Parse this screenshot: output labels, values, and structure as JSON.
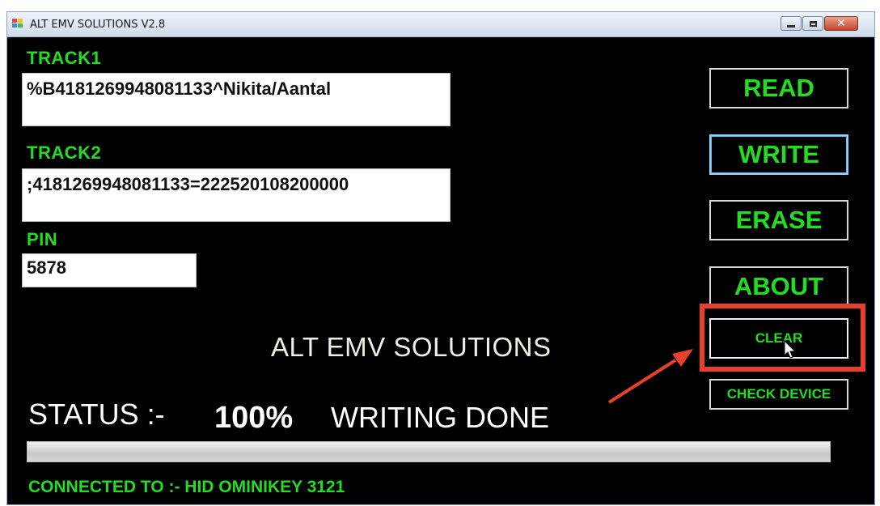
{
  "window": {
    "title": "ALT EMV SOLUTIONS V2.8",
    "close_glyph": "✕"
  },
  "fields": {
    "track1": {
      "label": "TRACK1",
      "value": "%B4181269948081133^Nikita/Aantal"
    },
    "track2": {
      "label": "TRACK2",
      "value": ";4181269948081133=222520108200000"
    },
    "pin": {
      "label": "PIN",
      "value": "5878"
    }
  },
  "buttons": {
    "read": "READ",
    "write": "WRITE",
    "erase": "ERASE",
    "about": "ABOUT",
    "clear": "CLEAR",
    "check_device": "CHECK DEVICE"
  },
  "brand_title": "ALT EMV SOLUTIONS",
  "status": {
    "label": "STATUS :-",
    "percent": "100%",
    "message": "WRITING DONE",
    "progress_fraction": 1.0
  },
  "connected": "CONNECTED TO :- HID OMINIKEY 3121",
  "colors": {
    "background": "#000000",
    "label_green": "#22dd22",
    "highlight": "#e8402a"
  },
  "icons": [
    "app-icon",
    "minimize-icon",
    "maximize-icon",
    "close-icon",
    "arrow-annotation",
    "mouse-cursor-icon"
  ]
}
